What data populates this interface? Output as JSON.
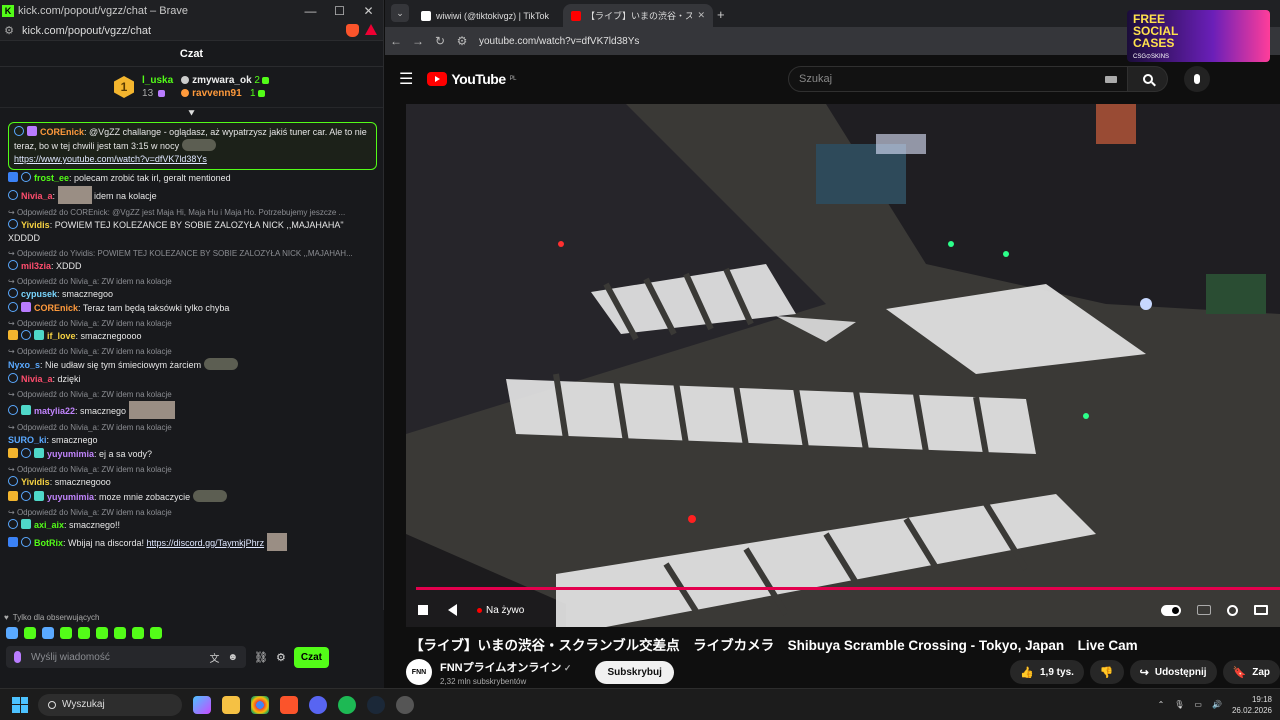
{
  "kick_window": {
    "title": "kick.com/popout/vgzz/chat – Brave",
    "url": "kick.com/popout/vgzz/chat",
    "header": "Czat",
    "leaderboard": {
      "rank_badge": "1",
      "first": {
        "name": "l_uska",
        "count": "13"
      },
      "second": {
        "name": "zmywara_ok",
        "count": "2"
      },
      "third": {
        "name": "ravvenn91",
        "count": "1"
      }
    },
    "pinned_partial": "Nivia_a: ZW idem na kolacje",
    "messages": [
      {
        "user": "COREnick",
        "text": ": @VgZZ challange - oglądasz, aż wypatrzysz jakiś tuner car. Ale to nie teraz, bo w tej chwili jest tam 3:15 w nocy",
        "link": "https://www.youtube.com/watch?v=dfVK7ld38Ys"
      },
      {
        "user": "frost_ee",
        "text": ": polecam zrobić tak irl, geralt mentioned"
      },
      {
        "user": "Nivia_a",
        "text": " idem na kolacje"
      },
      {
        "reply": "Odpowiedź do COREnick: @VgZZ jest Maja Hi, Maja Hu i Maja Ho. Potrzebujemy jeszcze ...",
        "user": "Yividis",
        "text": ": POWIEM TEJ KOLEZANCE BY SOBIE ZALOZYŁA NICK ,,MAJAHAHA\" XDDDD"
      },
      {
        "reply": "Odpowiedź do Yividis: POWIEM TEJ KOLEZANCE BY SOBIE ZALOZYŁA NICK ,,MAJAHAH...",
        "user": "mil3zia",
        "text": ": XDDD"
      },
      {
        "reply": "Odpowiedź do Nivia_a: ZW idem na kolacje",
        "user": "cypusek",
        "text": ": smacznegoo"
      },
      {
        "user": "COREnick",
        "text": ": Teraz tam będą taksówki tylko chyba"
      },
      {
        "reply": "Odpowiedź do Nivia_a: ZW idem na kolacje",
        "user": "if_love",
        "text": ": smacznegoooo"
      },
      {
        "reply": "Odpowiedź do Nivia_a: ZW idem na kolacje",
        "user": "Nyxo_s",
        "text": ": Nie udław się tym śmieciowym żarciem"
      },
      {
        "user": "Nivia_a",
        "text": ": dzięki"
      },
      {
        "reply": "Odpowiedź do Nivia_a: ZW idem na kolacje",
        "user": "matylia22",
        "text": ": smacznego"
      },
      {
        "reply": "Odpowiedź do Nivia_a: ZW idem na kolacje",
        "user": "SURO_ki",
        "text": ": smacznego"
      },
      {
        "user": "yuyumimia",
        "text": ": ej a sa vody?"
      },
      {
        "reply": "Odpowiedź do Nivia_a: ZW idem na kolacje",
        "user": "Yividis",
        "text": ": smacznegooo"
      },
      {
        "user": "yuyumimia",
        "text": ": moze mnie zobaczycie"
      },
      {
        "reply": "Odpowiedź do Nivia_a: ZW idem na kolacje",
        "user": "axi_aix",
        "text": ": smacznego!!"
      },
      {
        "user": "BotRix",
        "text": ": Wbijaj na discorda! ",
        "link": "https://discord.gg/TaymkjPhrz"
      }
    ],
    "followers_only": "Tylko dla obserwujących",
    "input_placeholder": "Wyślij wiadomość",
    "send_button": "Czat"
  },
  "browser": {
    "tabs": [
      {
        "title": "wiwiwi (@tiktokivgz) | TikTok"
      },
      {
        "title": "【ライブ】いまの渋谷・スクランブル"
      }
    ],
    "url": "youtube.com/watch?v=dfVK7ld38Ys",
    "ad": {
      "line1": "FREE",
      "line2": "SOCIAL",
      "line3": "CASES",
      "brand": "CSG⊙SKINS"
    }
  },
  "youtube": {
    "logo_text": "YouTube",
    "country": "PL",
    "search_placeholder": "Szukaj",
    "live_label": "Na żywo",
    "video_title": "【ライブ】いまの渋谷・スクランブル交差点　ライブカメラ　Shibuya Scramble Crossing - Tokyo, Japan　Live Cam",
    "channel_name": "FNNプライムオンライン",
    "channel_avatar": "FNN",
    "subscribers": "2,32 mln subskrybentów",
    "subscribe_label": "Subskrybuj",
    "likes": "1,9 tys.",
    "share_label": "Udostępnij",
    "save_label_partial": "Zap"
  },
  "taskbar": {
    "search_label": "Wyszukaj",
    "time": "19:18",
    "date": "26.02.2026"
  }
}
